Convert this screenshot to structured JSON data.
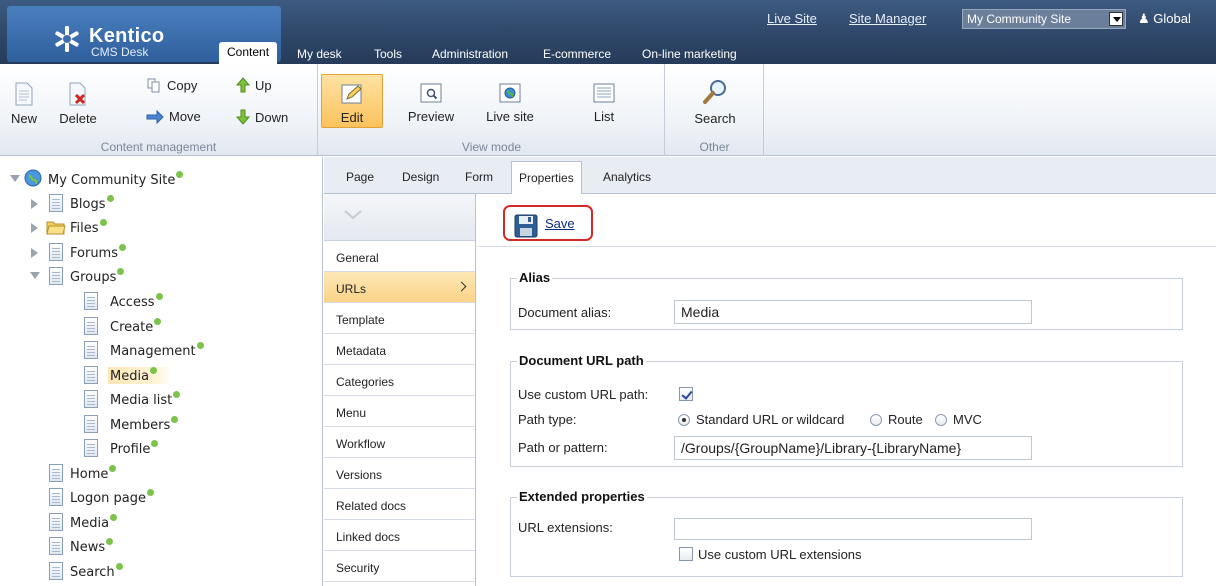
{
  "app": {
    "brand": "Kentico",
    "subtitle": "CMS Desk"
  },
  "top_links": {
    "live_site": "Live Site",
    "site_manager": "Site Manager",
    "site_select": "My Community Site",
    "user": "Global"
  },
  "main_tabs": [
    "Content",
    "My desk",
    "Tools",
    "Administration",
    "E-commerce",
    "On-line marketing"
  ],
  "ribbon": {
    "content_management": {
      "label": "Content management",
      "new": "New",
      "delete": "Delete",
      "copy": "Copy",
      "move": "Move",
      "up": "Up",
      "down": "Down"
    },
    "view_mode": {
      "label": "View mode",
      "edit": "Edit",
      "preview": "Preview",
      "live_site": "Live site",
      "list": "List"
    },
    "other": {
      "label": "Other",
      "search": "Search"
    }
  },
  "tree": {
    "root": "My Community Site",
    "items": [
      "Blogs",
      "Files",
      "Forums",
      "Groups",
      "Access",
      "Create",
      "Management",
      "Media",
      "Media list",
      "Members",
      "Profile",
      "Home",
      "Logon page",
      "Media",
      "News",
      "Search"
    ],
    "selected": "Media"
  },
  "page_tabs": [
    "Page",
    "Design",
    "Form",
    "Properties",
    "Analytics"
  ],
  "side_menu": [
    "General",
    "URLs",
    "Template",
    "Metadata",
    "Categories",
    "Menu",
    "Workflow",
    "Versions",
    "Related docs",
    "Linked docs",
    "Security"
  ],
  "save_label": "Save",
  "alias": {
    "legend": "Alias",
    "document_alias_label": "Document alias:",
    "document_alias_value": "Media"
  },
  "url_path": {
    "legend": "Document URL path",
    "use_custom_label": "Use custom URL path:",
    "use_custom_checked": true,
    "path_type_label": "Path type:",
    "path_type_options": [
      "Standard URL or wildcard",
      "Route",
      "MVC"
    ],
    "path_type_selected": "Standard URL or wildcard",
    "path_pattern_label": "Path or pattern:",
    "path_pattern_value": "/Groups/{GroupName}/Library-{LibraryName}"
  },
  "extended": {
    "legend": "Extended properties",
    "url_extensions_label": "URL extensions:",
    "url_extensions_value": "",
    "use_custom_ext_label": "Use custom URL extensions",
    "use_custom_ext_checked": false
  }
}
